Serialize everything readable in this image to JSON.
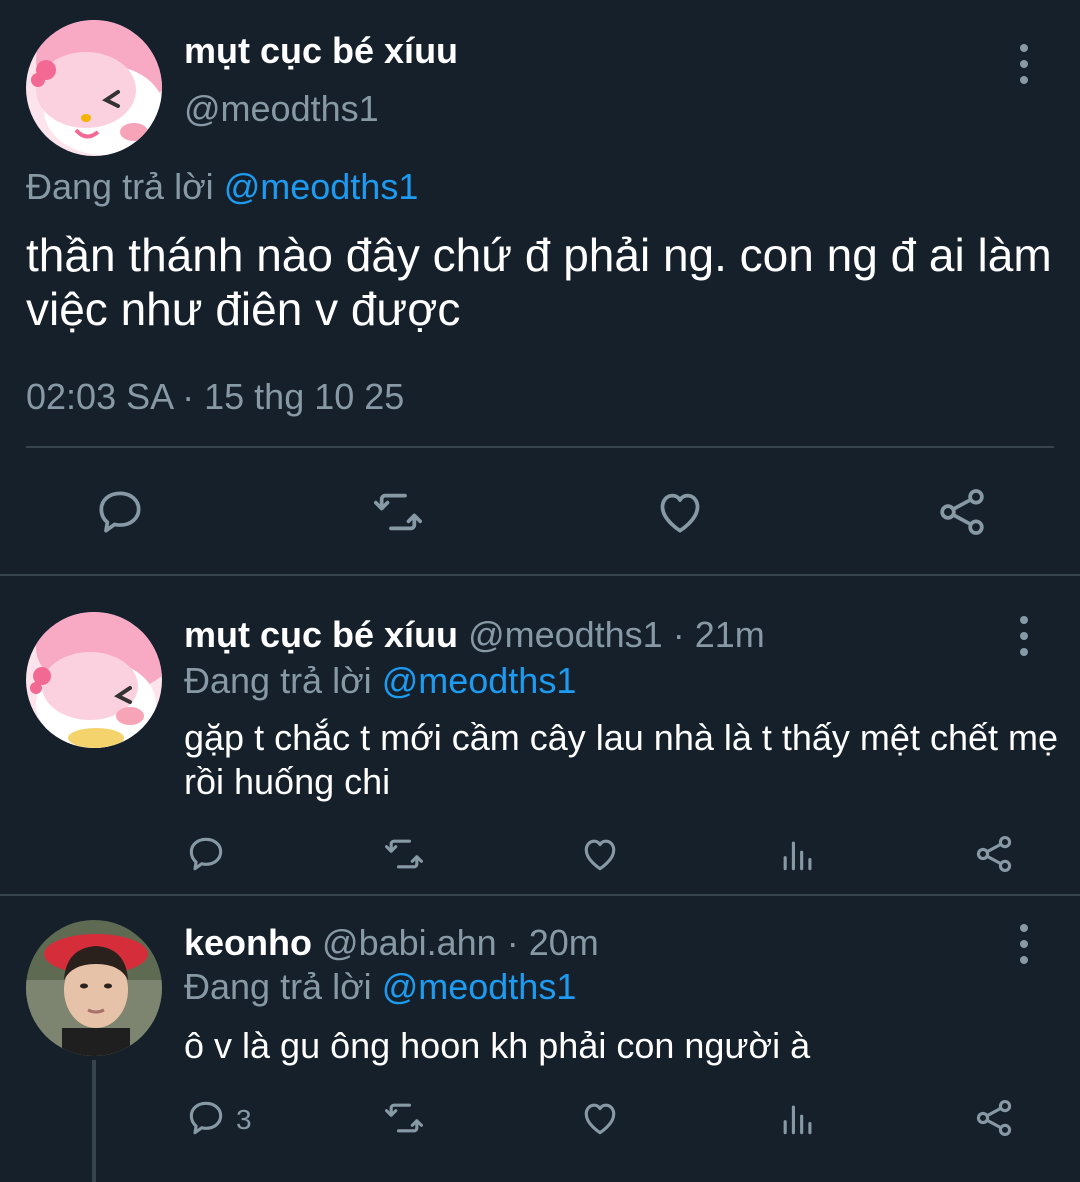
{
  "main_tweet": {
    "author_name": "mụt cục bé xíuu",
    "author_handle": "@meodths1",
    "replying_prefix": "Đang trả lời",
    "replying_to": "@meodths1",
    "text": "thần thánh nào đây chứ đ phải ng. con ng đ ai làm việc như điên v được",
    "timestamp": "02:03 SA · 15 thg 10 25",
    "actions": [
      "reply-icon",
      "retweet-icon",
      "like-icon",
      "share-icon"
    ]
  },
  "replies": [
    {
      "author_name": "mụt cục bé xíuu",
      "author_handle": "@meodths1",
      "time": "· 21m",
      "replying_prefix": "Đang trả lời",
      "replying_to": "@meodths1",
      "text": "gặp t chắc t mới cầm cây lau nhà là t thấy mệt chết mẹ rồi huống chi",
      "reply_count": "",
      "actions": [
        "reply-icon",
        "retweet-icon",
        "like-icon",
        "analytics-icon",
        "share-icon"
      ]
    },
    {
      "author_name": "keonho",
      "author_handle": "@babi.ahn",
      "time": "· 20m",
      "replying_prefix": "Đang trả lời",
      "replying_to": "@meodths1",
      "text": "ô v là gu ông hoon kh phải con người à",
      "reply_count": "3",
      "actions": [
        "reply-icon",
        "retweet-icon",
        "like-icon",
        "analytics-icon",
        "share-icon"
      ]
    }
  ],
  "colors": {
    "background": "#15202b",
    "text_primary": "#ffffff",
    "text_secondary": "#8899a6",
    "accent": "#1d9bf0",
    "divider": "#38444d"
  }
}
